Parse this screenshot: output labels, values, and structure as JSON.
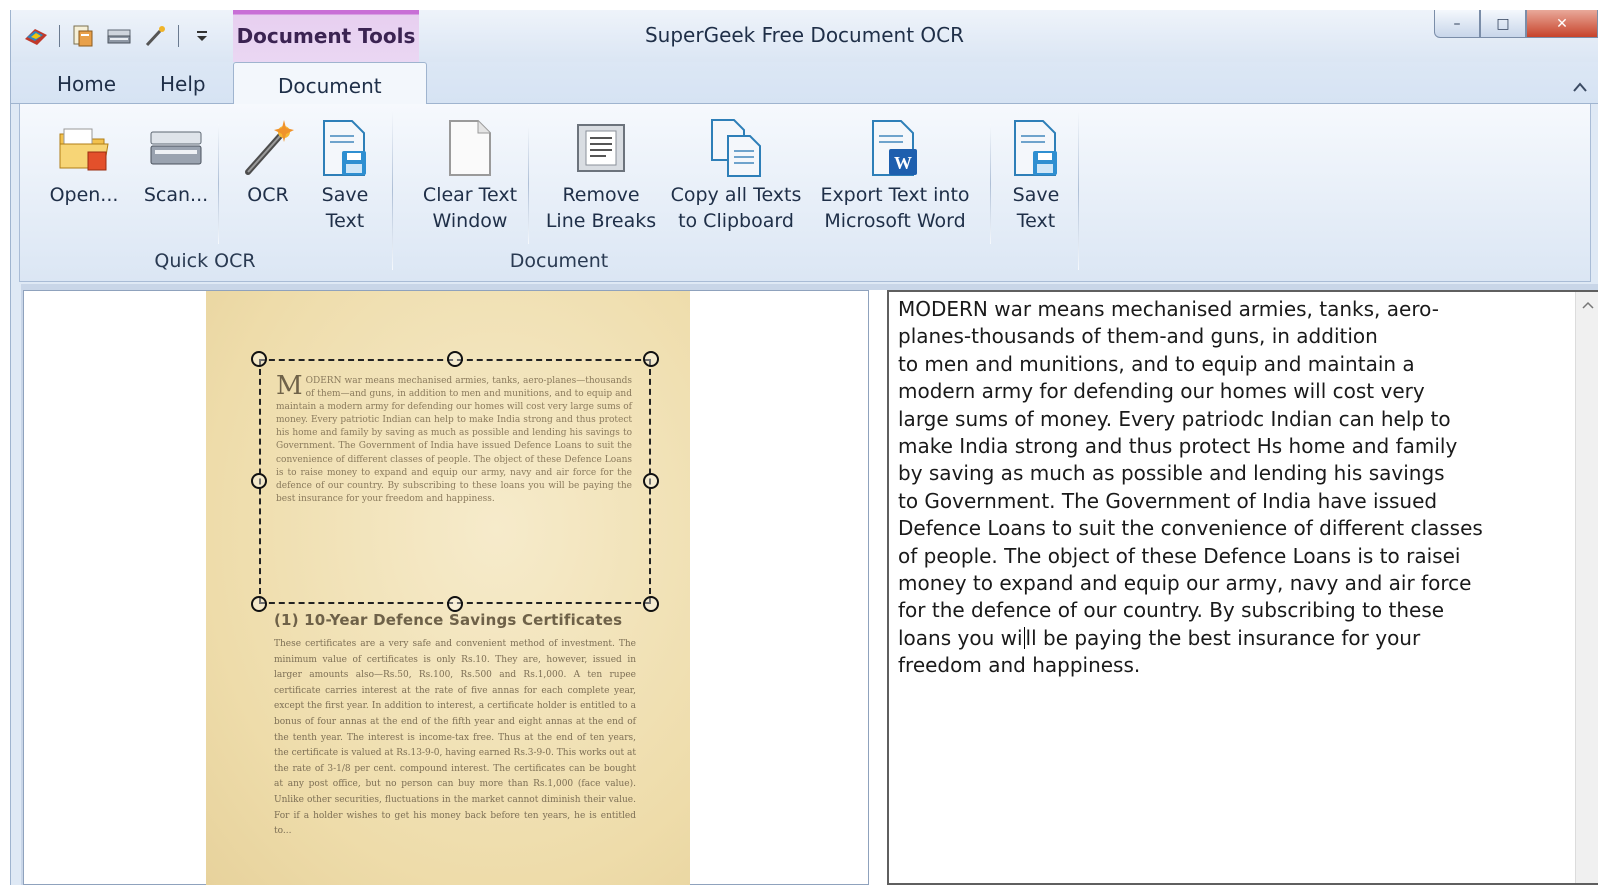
{
  "window": {
    "title": "SuperGeek Free Document OCR",
    "context_tab": "Document Tools",
    "controls": {
      "minimize": "–",
      "maximize": "□",
      "close": "✕"
    }
  },
  "quick_access": {
    "icons": [
      "colors-icon",
      "document-icon",
      "scanner-icon",
      "wand-icon",
      "customize-dropdown-icon"
    ]
  },
  "tabs": [
    {
      "label": "Home",
      "active": false
    },
    {
      "label": "Help",
      "active": false
    },
    {
      "label": "Document",
      "active": true
    }
  ],
  "ribbon": {
    "groups": [
      {
        "label": "Quick OCR",
        "buttons": [
          {
            "label": "Open...",
            "icon": "open-folder-icon"
          },
          {
            "label": "Scan...",
            "icon": "scanner-icon"
          },
          {
            "label": "OCR",
            "icon": "magic-wand-icon"
          },
          {
            "label": "Save\nText",
            "icon": "save-text-icon"
          }
        ]
      },
      {
        "label": "Document",
        "buttons": [
          {
            "label": "Clear Text\nWindow",
            "icon": "blank-page-icon"
          },
          {
            "label": "Remove\nLine Breaks",
            "icon": "text-page-icon"
          },
          {
            "label": "Copy all Texts\nto Clipboard",
            "icon": "copy-pages-icon"
          },
          {
            "label": "Export Text into\nMicrosoft Word",
            "icon": "word-document-icon"
          },
          {
            "label": "Save\nText",
            "icon": "save-text-icon"
          }
        ]
      }
    ]
  },
  "scan_preview": {
    "paragraph": "ODERN war means mechanised armies, tanks, aero-planes—thousands of them—and guns, in addition to men and munitions, and to equip and maintain a modern army for defending our homes will cost very large sums of money. Every patriotic Indian can help to make India strong and thus protect his home and family by saving as much as possible and lending his savings to Government. The Government of India have issued Defence Loans to suit the convenience of different classes of people. The object of these Defence Loans is to raise money to expand and equip our army, navy and air force for the defence of our country. By subscribing to these loans you will be paying the best insurance for your freedom and happiness.",
    "drop_cap": "M",
    "heading": "(1) 10-Year Defence Savings Certificates",
    "paragraph2": "These certificates are a very safe and convenient method of investment. The minimum value of certificates is only Rs.10. They are, however, issued in larger amounts also—Rs.50, Rs.100, Rs.500 and Rs.1,000. A ten rupee certificate carries interest at the rate of five annas for each complete year, except the first year. In addition to interest, a certificate holder is entitled to a bonus of four annas at the end of the fifth year and eight annas at the end of the tenth year. The interest is income-tax free. Thus at the end of ten years, the certificate is valued at Rs.13-9-0, having earned Rs.3-9-0. This works out at the rate of 3-1/8 per cent. compound interest. The certificates can be bought at any post office, but no person can buy more than Rs.1,000 (face value). Unlike other securities, fluctuations in the market cannot diminish their value. For if a holder wishes to get his money back before ten years, he is entitled to..."
  },
  "ocr_output": {
    "text_before_caret": "MODERN war means mechanised armies, tanks, aero-\nplanes-thousands of them-and guns, in addition\nto men and munitions, and to equip and maintain a\nmodern army for defending our homes will cost very\nlarge sums of money. Every patriodc Indian can help to\nmake India strong and thus protect Hs home and family\nby saving as much as possible and lending his savings\nto Government. The Government of India have issued\nDefence Loans to suit the convenience of different classes\nof people. The object of these Defence Loans is to raisei\nmoney to expand and equip our army, navy and air force\nfor the defence of our country. By subscribing to these\nloans you wi",
    "text_after_caret": "ll be paying the best insurance for your\nfreedom and happiness."
  }
}
